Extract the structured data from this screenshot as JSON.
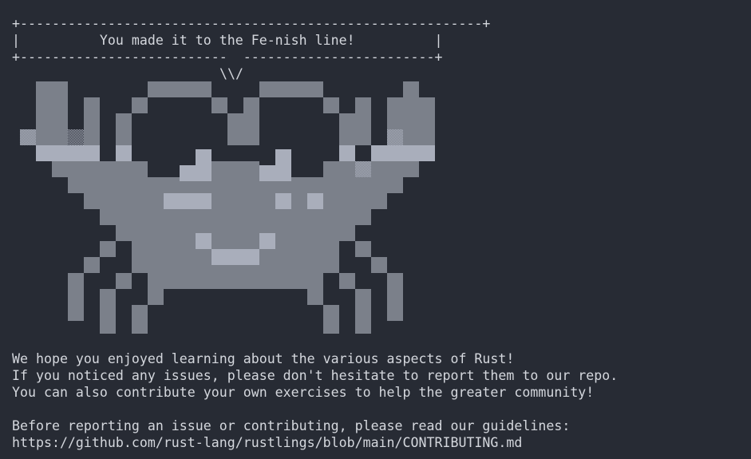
{
  "terminal": {
    "banner": {
      "top_border": "+----------------------------------------------------------+",
      "message_line": "|          You made it to the Fe-nish line!          |",
      "bottom_border": "+--------------------------  ------------------------+",
      "speech_tail": "\\\\/"
    },
    "messages": [
      "We hope you enjoyed learning about the various aspects of Rust!",
      "If you noticed any issues, please don't hesitate to report them to our repo.",
      "You can also contribute your own exercises to help the greater community!",
      "Before reporting an issue or contributing, please read our guidelines:",
      "https://github.com/rust-lang/rustlings/blob/main/CONTRIBUTING.md"
    ],
    "colors": {
      "background": "#272b34",
      "text": "#d4d7dd",
      "shade_medium": "#7b808a",
      "shade_light": "#a9aebb",
      "shade_dark": "#4d525d"
    }
  }
}
